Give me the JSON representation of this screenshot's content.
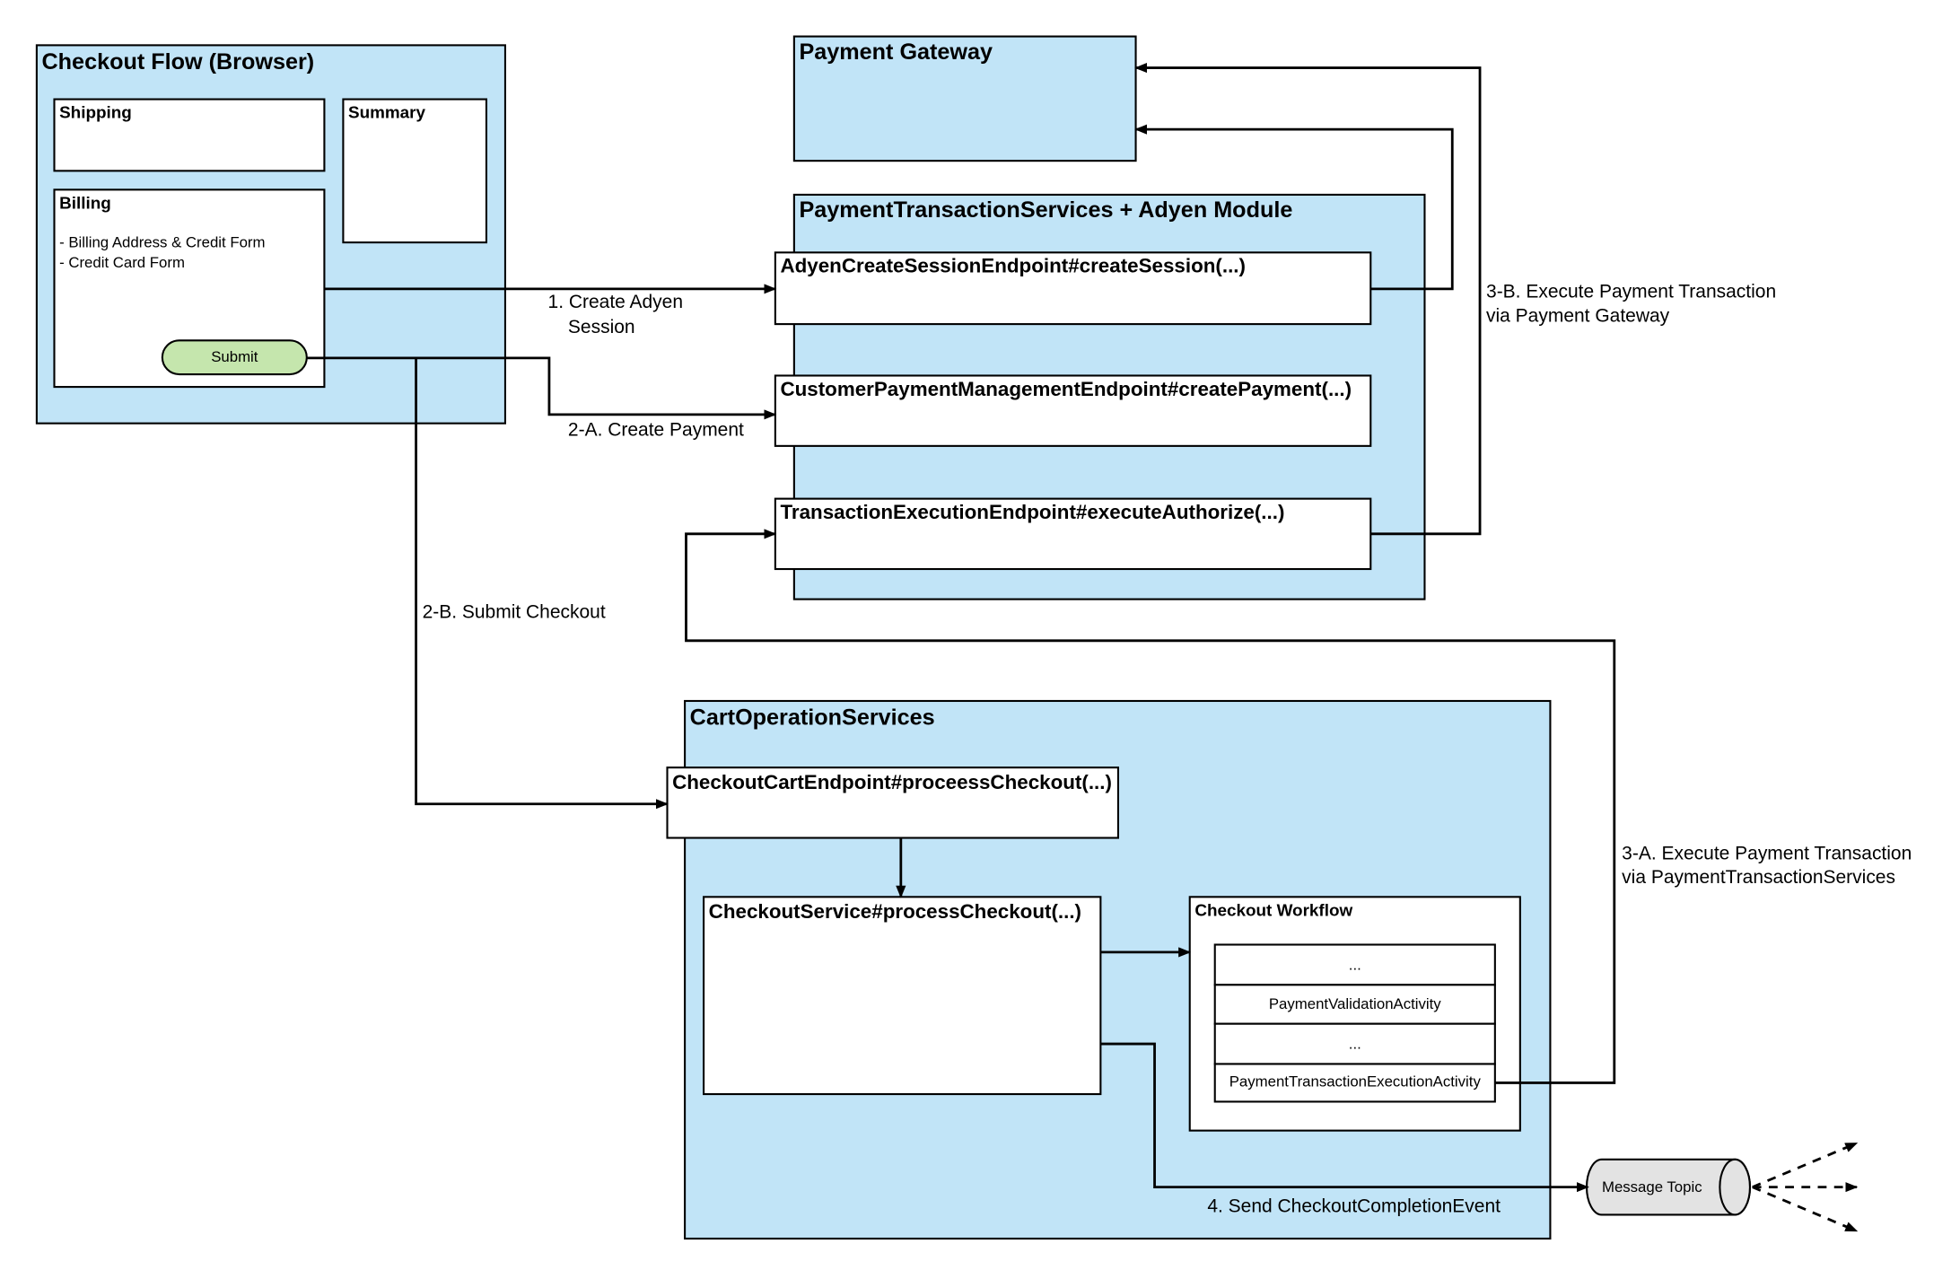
{
  "colors": {
    "group_fill": "#c1e4f7",
    "submit_fill": "#c5e6ad",
    "topic_fill": "#e3e3e3"
  },
  "checkout_flow": {
    "title": "Checkout Flow (Browser)",
    "shipping": "Shipping",
    "summary": "Summary",
    "billing": {
      "title": "Billing",
      "items": [
        "- Billing Address & Credit Form",
        "- Credit Card Form"
      ]
    },
    "submit": "Submit"
  },
  "payment_gateway": {
    "title": "Payment Gateway"
  },
  "payment_services": {
    "title": "PaymentTransactionServices + Adyen Module",
    "endpoints": [
      "AdyenCreateSessionEndpoint#createSession(...)",
      "CustomerPaymentManagementEndpoint#createPayment(...)",
      "TransactionExecutionEndpoint#executeAuthorize(...)"
    ]
  },
  "cart_services": {
    "title": "CartOperationServices",
    "endpoint": "CheckoutCartEndpoint#proceessCheckout(...)",
    "service": "CheckoutService#processCheckout(...)",
    "workflow": {
      "title": "Checkout Workflow",
      "activities": [
        "...",
        "PaymentValidationActivity",
        "...",
        "PaymentTransactionExecutionActivity"
      ]
    }
  },
  "message_topic": "Message Topic",
  "edges": {
    "e1": [
      "1. Create Adyen",
      "Session"
    ],
    "e2a": "2-A. Create Payment",
    "e2b": "2-B. Submit Checkout",
    "e3a": [
      "3-A. Execute Payment Transaction",
      "via PaymentTransactionServices"
    ],
    "e3b": [
      "3-B. Execute Payment Transaction",
      "via Payment Gateway"
    ],
    "e4": "4. Send CheckoutCompletionEvent"
  }
}
